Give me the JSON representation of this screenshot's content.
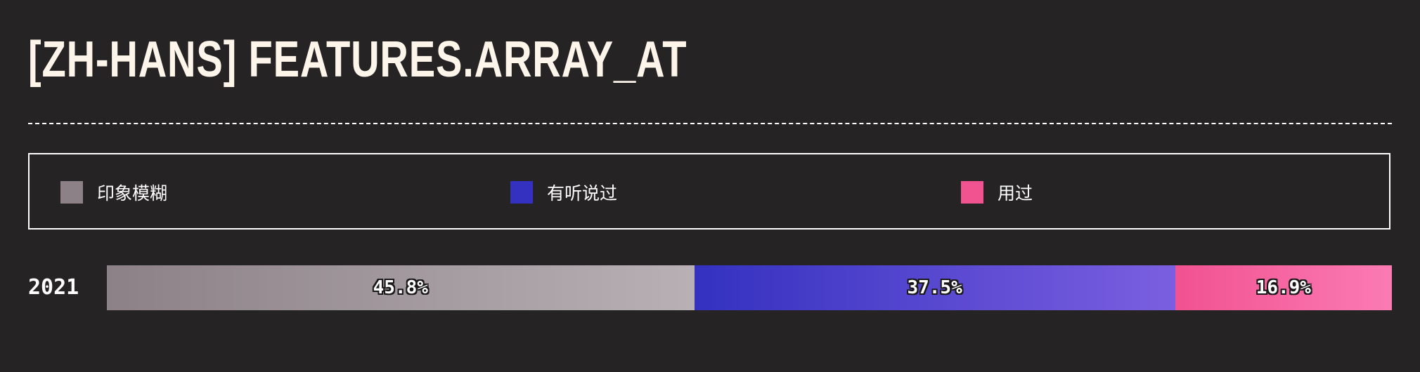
{
  "title": "[ZH-HANS] FEATURES.ARRAY_AT",
  "legend": {
    "items": [
      {
        "label": "印象模糊",
        "color": "#8b8187"
      },
      {
        "label": "有听说过",
        "color": "#3431c0"
      },
      {
        "label": "用过",
        "color": "#f15290"
      }
    ]
  },
  "chart_data": {
    "type": "bar",
    "orientation": "horizontal",
    "stacked": true,
    "categories": [
      "2021"
    ],
    "series": [
      {
        "name": "印象模糊",
        "values": [
          45.8
        ],
        "label": "45.8%",
        "color": "#8b8187",
        "color_end": "#b8b0b4"
      },
      {
        "name": "有听说过",
        "values": [
          37.5
        ],
        "label": "37.5%",
        "color": "#3431c0",
        "color_end": "#7b5fe0"
      },
      {
        "name": "用过",
        "values": [
          16.9
        ],
        "label": "16.9%",
        "color": "#f15290",
        "color_end": "#fb7bb4"
      }
    ],
    "legend_position": "top",
    "grid": false
  }
}
